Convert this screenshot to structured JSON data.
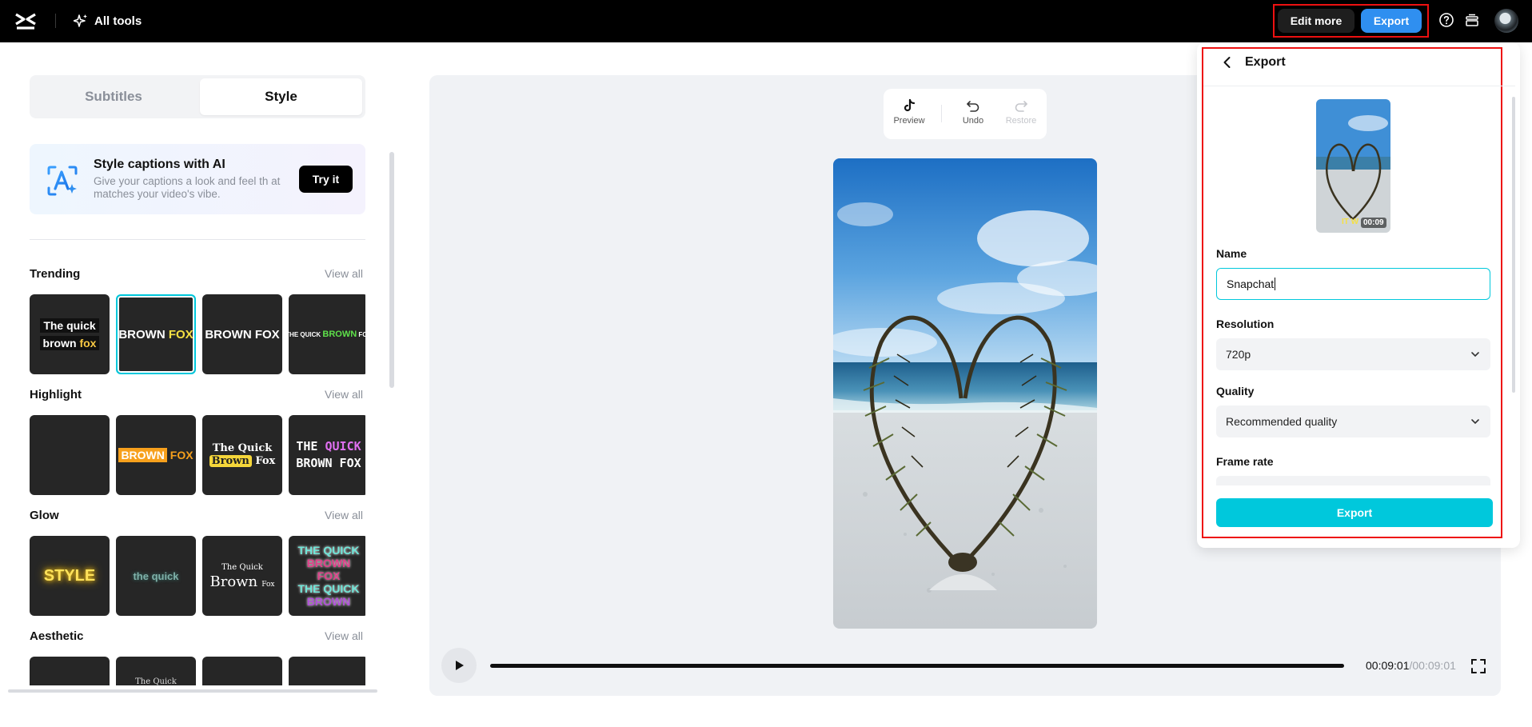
{
  "topbar": {
    "logo_icon": "capcut-logo-icon",
    "all_tools_label": "All tools",
    "edit_more_label": "Edit more",
    "export_label": "Export",
    "help_icon": "help-circle-icon",
    "stack_icon": "layers-icon",
    "accent_color": "#2f8ff0"
  },
  "left_panel": {
    "tabs": [
      {
        "label": "Subtitles",
        "active": false
      },
      {
        "label": "Style",
        "active": true
      }
    ],
    "ai_card": {
      "title": "Style captions with AI",
      "description": "Give your captions a look and feel th at matches your video's vibe.",
      "button_label": "Try it"
    },
    "view_all_label": "View all",
    "sections": [
      {
        "title": "Trending",
        "tiles": [
          "The quick brown fox",
          "BROWN FOX",
          "BROWN FOX",
          "THE QUICK BROWN FOX"
        ]
      },
      {
        "title": "Highlight",
        "tiles": [
          "",
          "BROWN FOX",
          "The Quick Brown Fox",
          "THE QUICK BROWN FOX"
        ]
      },
      {
        "title": "Glow",
        "tiles": [
          "STYLE",
          "the quick",
          "The Quick Brown Fox",
          "THE QUICK BROWN FOX THE QUICK BROWN"
        ]
      },
      {
        "title": "Aesthetic",
        "tiles": [
          "",
          "The Quick",
          "",
          ""
        ]
      }
    ],
    "tile_text": {
      "t1_line1": "The quick",
      "t1_brown": "brown",
      "t1_fox": "fox",
      "t2_brown": "BROWN",
      "t2_fox": "FOX",
      "t3": "BROWN FOX",
      "t4_a": "THE QUICK",
      "t4_b": "BROWN",
      "t4_c": "FOX",
      "h2_brown": "BROWN",
      "h2_fox": "FOX",
      "h3_line1": "The Quick",
      "h3_brown": "Brown",
      "h3_fox": "Fox",
      "h4_the": "THE",
      "h4_quick": "QUICK",
      "h4_line2": "BROWN FOX",
      "g1": "STYLE",
      "g2": "the quick",
      "g3_line1": "The Quick",
      "g3_brown": "Brown",
      "g3_fox": "Fox",
      "g4_a": "THE QUICK",
      "g4_b": "BROWN",
      "g4_c": "FOX",
      "g4_d": "THE QUICK",
      "g4_e": "BROWN",
      "a2": "The Quick"
    }
  },
  "preview": {
    "toolbar": [
      {
        "label": "Preview",
        "icon": "tiktok-icon",
        "enabled": true
      },
      {
        "label": "Undo",
        "icon": "undo-icon",
        "enabled": true
      },
      {
        "label": "Restore",
        "icon": "redo-icon",
        "enabled": false
      }
    ],
    "current_time": "00:09:01",
    "separator": "/",
    "duration": "00:09:01",
    "progress": 1.0
  },
  "export_panel": {
    "title": "Export",
    "thumb_duration": "00:09",
    "thumb_caption": "IT W",
    "name_label": "Name",
    "name_value": "Snapchat",
    "resolution_label": "Resolution",
    "resolution_value": "720p",
    "quality_label": "Quality",
    "quality_value": "Recommended quality",
    "frame_rate_label": "Frame rate",
    "export_button_label": "Export",
    "accent_color": "#00c8dc"
  }
}
